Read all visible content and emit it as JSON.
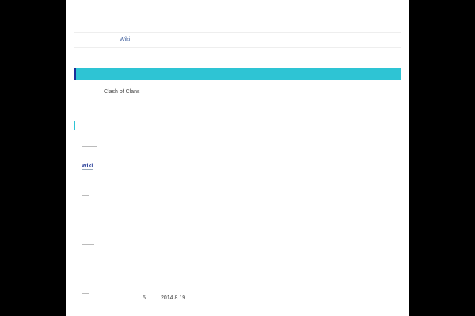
{
  "breadcrumb": {
    "label": "Wiki"
  },
  "main": {
    "game_title": "Clash of Clans",
    "links": [
      {
        "label": ""
      },
      {
        "label": "Wiki"
      },
      {
        "label": ""
      },
      {
        "label": ""
      },
      {
        "label": ""
      },
      {
        "label": ""
      },
      {
        "label": ""
      }
    ],
    "footer": {
      "count": "5",
      "date": "2014 8 19"
    }
  },
  "colors": {
    "accent": "#2ec4d4",
    "accent_dark": "#1a2f9a",
    "link": "#2a3f9a"
  }
}
